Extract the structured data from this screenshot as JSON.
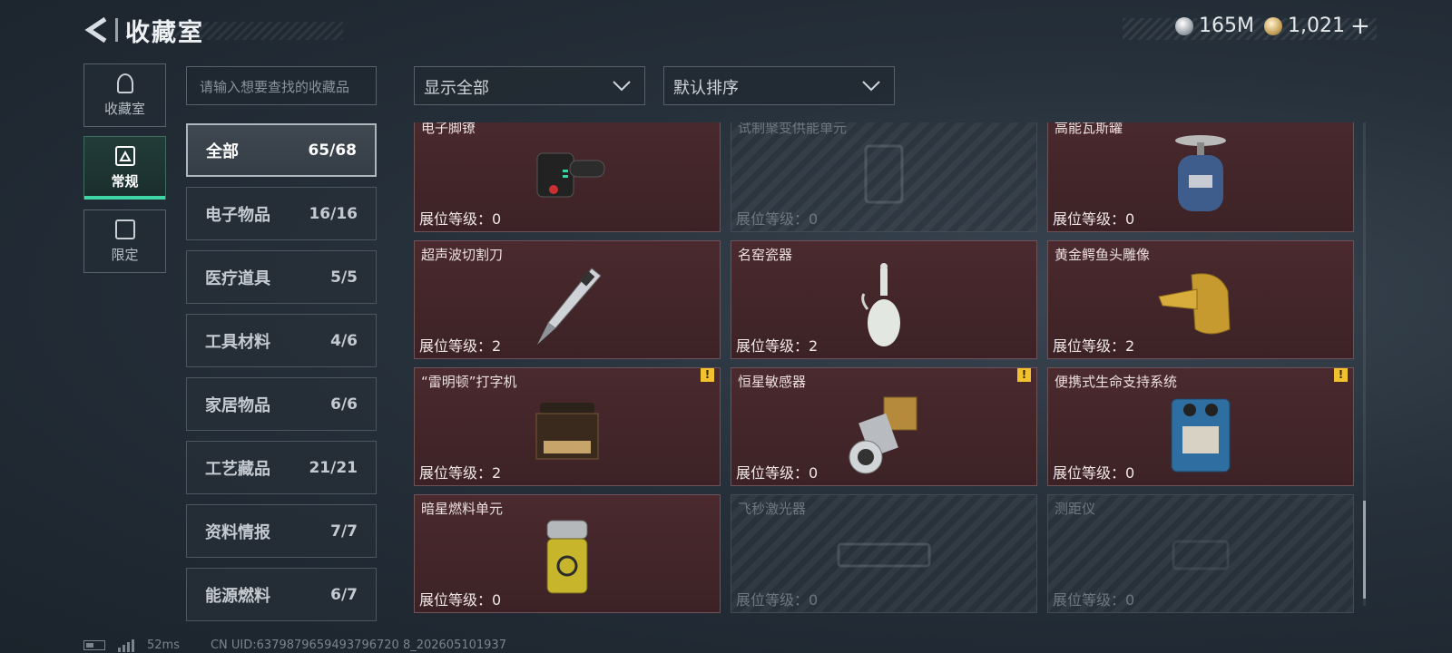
{
  "header": {
    "title": "收藏室",
    "currency_silver": "165M",
    "currency_gold": "1,021"
  },
  "side_tabs": [
    {
      "label": "收藏室",
      "icon": "trophy-icon"
    },
    {
      "label": "常规",
      "icon": "document-icon"
    },
    {
      "label": "限定",
      "icon": "limited-icon"
    }
  ],
  "search": {
    "placeholder": "请输入想要查找的收藏品"
  },
  "categories": [
    {
      "name": "全部",
      "count": "65/68"
    },
    {
      "name": "电子物品",
      "count": "16/16"
    },
    {
      "name": "医疗道具",
      "count": "5/5"
    },
    {
      "name": "工具材料",
      "count": "4/6"
    },
    {
      "name": "家居物品",
      "count": "6/6"
    },
    {
      "name": "工艺藏品",
      "count": "21/21"
    },
    {
      "name": "资料情报",
      "count": "7/7"
    },
    {
      "name": "能源燃料",
      "count": "6/7"
    }
  ],
  "filters": {
    "display": "显示全部",
    "sort": "默认排序"
  },
  "items": [
    {
      "name": "电子脚镣",
      "level": "展位等级：0",
      "owned": true,
      "warn": false,
      "icon": "ankle-monitor-icon"
    },
    {
      "name": "试制聚变供能单元",
      "level": "展位等级：0",
      "owned": false,
      "warn": false,
      "icon": "fusion-unit-icon"
    },
    {
      "name": "高能瓦斯罐",
      "level": "展位等级：0",
      "owned": true,
      "warn": false,
      "icon": "gas-canister-icon"
    },
    {
      "name": "超声波切割刀",
      "level": "展位等级：2",
      "owned": true,
      "warn": false,
      "icon": "ultrasonic-knife-icon"
    },
    {
      "name": "名窑瓷器",
      "level": "展位等级：2",
      "owned": true,
      "warn": false,
      "icon": "porcelain-vase-icon"
    },
    {
      "name": "黄金鳄鱼头雕像",
      "level": "展位等级：2",
      "owned": true,
      "warn": false,
      "icon": "gold-crocodile-icon"
    },
    {
      "name": "“雷明顿”打字机",
      "level": "展位等级：2",
      "owned": true,
      "warn": true,
      "icon": "typewriter-icon"
    },
    {
      "name": "恒星敏感器",
      "level": "展位等级：0",
      "owned": true,
      "warn": true,
      "icon": "star-sensor-icon"
    },
    {
      "name": "便携式生命支持系统",
      "level": "展位等级：0",
      "owned": true,
      "warn": true,
      "icon": "life-support-icon"
    },
    {
      "name": "暗星燃料单元",
      "level": "展位等级：0",
      "owned": true,
      "warn": false,
      "icon": "fuel-cell-icon"
    },
    {
      "name": "飞秒激光器",
      "level": "展位等级：0",
      "owned": false,
      "warn": false,
      "icon": "laser-icon"
    },
    {
      "name": "测距仪",
      "level": "展位等级：0",
      "owned": false,
      "warn": false,
      "icon": "rangefinder-icon"
    }
  ],
  "footer": {
    "ping": "52ms",
    "uid": "CN UID:6379879659493796720 8_202605101937"
  }
}
